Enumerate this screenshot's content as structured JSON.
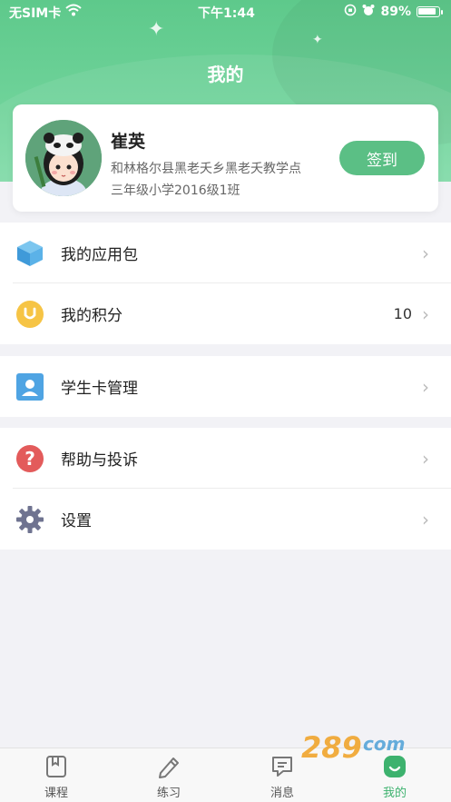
{
  "status_bar": {
    "carrier": "无SIM卡",
    "time": "下午1:44",
    "battery": "89%",
    "battery_level": 0.89
  },
  "header": {
    "title": "我的"
  },
  "profile": {
    "name": "崔英",
    "school": "和林格尔县黑老夭乡黑老夭教学点",
    "class": "三年级小学2016级1班",
    "checkin_label": "签到"
  },
  "menu": {
    "group1": [
      {
        "label": "我的应用包",
        "value": "",
        "icon": "cube-icon"
      },
      {
        "label": "我的积分",
        "value": "10",
        "icon": "points-icon"
      }
    ],
    "group2": [
      {
        "label": "学生卡管理",
        "value": "",
        "icon": "student-card-icon"
      }
    ],
    "group3": [
      {
        "label": "帮助与投诉",
        "value": "",
        "icon": "help-icon"
      },
      {
        "label": "设置",
        "value": "",
        "icon": "gear-icon"
      }
    ]
  },
  "tabbar": {
    "tabs": [
      {
        "label": "课程",
        "icon": "book-icon",
        "active": false
      },
      {
        "label": "练习",
        "icon": "pencil-icon",
        "active": false
      },
      {
        "label": "消息",
        "icon": "message-icon",
        "active": false
      },
      {
        "label": "我的",
        "icon": "profile-icon",
        "active": true
      }
    ]
  },
  "colors": {
    "brand_green": "#5bbf85",
    "active_tab": "#3db26e"
  }
}
